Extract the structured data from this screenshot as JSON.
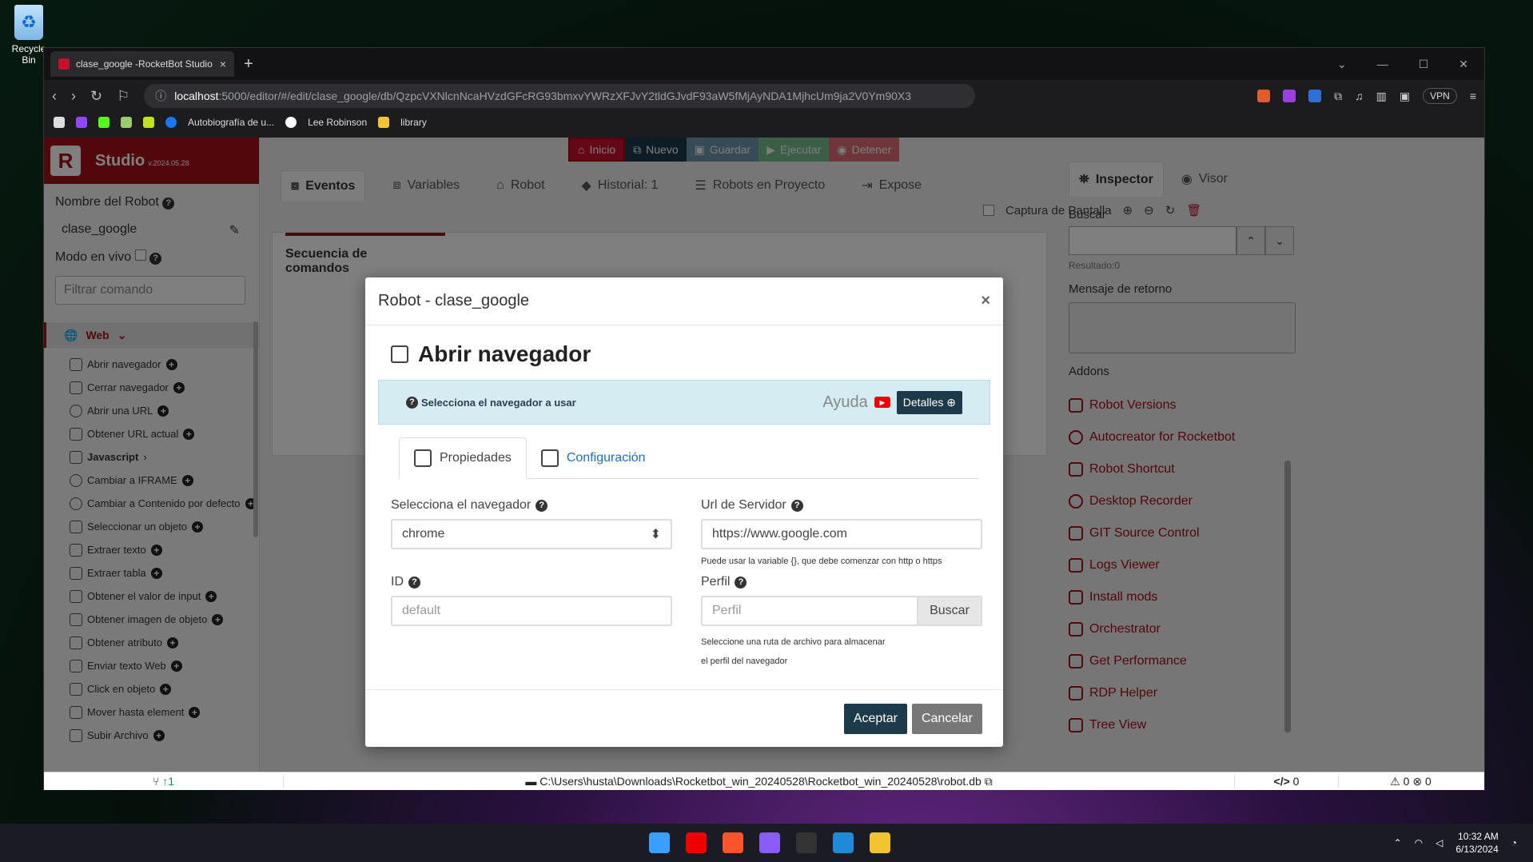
{
  "desktop": {
    "recycle_label": "Recycle Bin"
  },
  "browser": {
    "tab_title": "clase_google -RocketBot Studio",
    "url_host": "localhost",
    "url_rest": ":5000/editor/#/edit/clase_google/db/QzpcVXNlcnNcaHVzdGFcRG93bmxvYWRzXFJvY2tldGJvdF93aW5fMjAyNDA1MjhcUm9ja2V0Ym90X3",
    "vpn": "VPN",
    "bookmarks": [
      "Autobiografía de u...",
      "Lee Robinson",
      "library"
    ]
  },
  "studio": {
    "name": "Studio",
    "version": "v.2024.05.28"
  },
  "sidebar": {
    "robot_name_label": "Nombre del Robot",
    "robot_name": "clase_google",
    "live_mode_label": "Modo en vivo",
    "filter_placeholder": "Filtrar comando",
    "category": "Web",
    "commands": [
      "Abrir navegador",
      "Cerrar navegador",
      "Abrir una URL",
      "Obtener URL actual",
      "Javascript",
      "Cambiar a IFRAME",
      "Cambiar a Contenido por defecto",
      "Seleccionar un objeto",
      "Extraer texto",
      "Extraer tabla",
      "Obtener el valor de input",
      "Obtener imagen de objeto",
      "Obtener atributo",
      "Enviar texto Web",
      "Click en objeto",
      "Mover hasta element",
      "Subir Archivo"
    ]
  },
  "toolbar": {
    "inicio": "Inicio",
    "nuevo": "Nuevo",
    "guardar": "Guardar",
    "ejecutar": "Ejecutar",
    "detener": "Detener"
  },
  "center_tabs": {
    "eventos": "Eventos",
    "variables": "Variables",
    "robot": "Robot",
    "historial": "Historial: 1",
    "robots_proyecto": "Robots en Proyecto",
    "expose": "Expose"
  },
  "capture_label": "Captura de Pantalla",
  "sequence_title": "Secuencia de comandos",
  "right_panel": {
    "inspector": "Inspector",
    "visor": "Visor",
    "buscar": "Buscar",
    "resultado": "Resultado:0",
    "mensaje": "Mensaje de retorno",
    "addons_label": "Addons",
    "addons": [
      "Robot Versions",
      "Autocreator for Rocketbot",
      "Robot Shortcut",
      "Desktop Recorder",
      "GIT Source Control",
      "Logs Viewer",
      "Install mods",
      "Orchestrator",
      "Get Performance",
      "RDP Helper",
      "Tree View"
    ]
  },
  "statusbar": {
    "branch": "↑1",
    "path": "C:\\Users\\husta\\Downloads\\Rocketbot_win_20240528\\Rocketbot_win_20240528\\robot.db",
    "code": "0",
    "warnings": "0",
    "errors": "0"
  },
  "modal": {
    "header": "Robot - clase_google",
    "title": "Abrir navegador",
    "info_text": "Selecciona el navegador a usar",
    "ayuda": "Ayuda",
    "detalles": "Detalles",
    "tab_propiedades": "Propiedades",
    "tab_configuracion": "Configuración",
    "browser_label": "Selecciona el navegador",
    "browser_value": "chrome",
    "url_label": "Url de Servidor",
    "url_value": "https://www.google.com",
    "url_help": "Puede usar la variable {}, que debe comenzar con http o https",
    "id_label": "ID",
    "id_placeholder": "default",
    "perfil_label": "Perfil",
    "perfil_placeholder": "Perfil",
    "buscar": "Buscar",
    "perfil_help": "Seleccione una ruta de archivo para almacenar el perfil del navegador",
    "aceptar": "Aceptar",
    "cancelar": "Cancelar"
  },
  "taskbar": {
    "time": "10:32 AM",
    "date": "6/13/2024"
  }
}
